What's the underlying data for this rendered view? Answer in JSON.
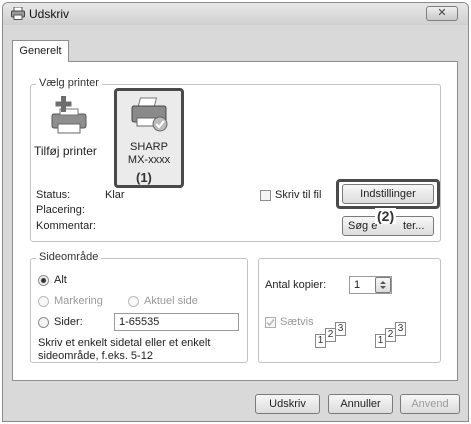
{
  "window": {
    "title": "Udskriv",
    "close_label": "✕"
  },
  "tabs": [
    {
      "label": "Generelt"
    }
  ],
  "printer_group": {
    "legend": "Vælg printer",
    "printers": [
      {
        "label": "Tilføj printer"
      },
      {
        "label_line1": "SHARP",
        "label_line2": "MX-xxxx"
      }
    ],
    "status_label": "Status:",
    "status_value": "Klar",
    "location_label": "Placering:",
    "comment_label": "Kommentar:",
    "print_to_file_label": "Skriv til fil",
    "settings_button": "Indstillinger",
    "find_printer_button_left": "Søg e",
    "find_printer_button_right": "ter..."
  },
  "callouts": {
    "one": "(1)",
    "two": "(2)"
  },
  "page_range": {
    "legend": "Sideområde",
    "all_label": "Alt",
    "selection_label": "Markering",
    "current_page_label": "Aktuel side",
    "pages_label": "Sider:",
    "pages_value": "1-65535",
    "hint": "Skriv et enkelt sidetal eller et enkelt sideområde, f.eks. 5-12"
  },
  "copies": {
    "label": "Antal kopier:",
    "value": "1",
    "collate_label": "Sætvis",
    "page_numbers": [
      "1",
      "2",
      "3"
    ]
  },
  "footer": {
    "print_button": "Udskriv",
    "cancel_button": "Annuller",
    "apply_button": "Anvend"
  }
}
